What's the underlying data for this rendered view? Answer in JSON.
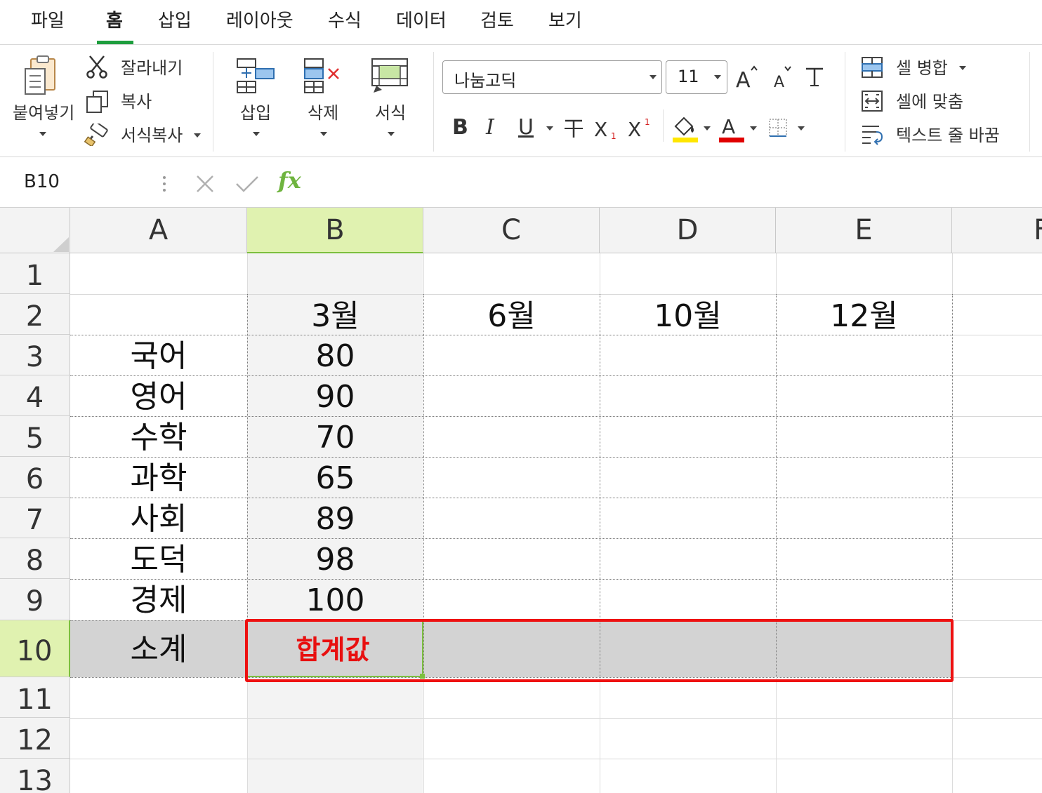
{
  "menu": {
    "items": [
      "파일",
      "홈",
      "삽입",
      "레이아웃",
      "수식",
      "데이터",
      "검토",
      "보기"
    ],
    "active": "홈"
  },
  "ribbon": {
    "paste_label": "붙여넣기",
    "cut_label": "잘라내기",
    "copy_label": "복사",
    "format_painter_label": "서식복사",
    "insert_label": "삽입",
    "delete_label": "삭제",
    "format_label": "서식",
    "font_name": "나눔고딕",
    "font_size": "11",
    "merge_label": "셀 병합",
    "fit_label": "셀에 맞춤",
    "wrap_label": "텍스트 줄 바꿈",
    "bold": "B",
    "italic": "I",
    "underline": "U",
    "highlight_color": "#ffe600",
    "font_color": "#e00000"
  },
  "formula_bar": {
    "name_box": "B10",
    "fx": "fx"
  },
  "sheet": {
    "columns": [
      "A",
      "B",
      "C",
      "D",
      "E",
      "F"
    ],
    "rows": [
      "1",
      "2",
      "3",
      "4",
      "5",
      "6",
      "7",
      "8",
      "9",
      "10",
      "11",
      "12",
      "13"
    ],
    "selected_cell": "B10",
    "header_row": [
      "",
      "3월",
      "6월",
      "10월",
      "12월"
    ],
    "subjects": [
      "국어",
      "영어",
      "수학",
      "과학",
      "사회",
      "도덕",
      "경제"
    ],
    "scores": [
      "80",
      "90",
      "70",
      "65",
      "89",
      "98",
      "100"
    ],
    "subtotal_label": "소계",
    "subtotal_value": "합계값",
    "highlight_border_color": "#ee1111",
    "subtotal_value_color": "#e81010"
  }
}
